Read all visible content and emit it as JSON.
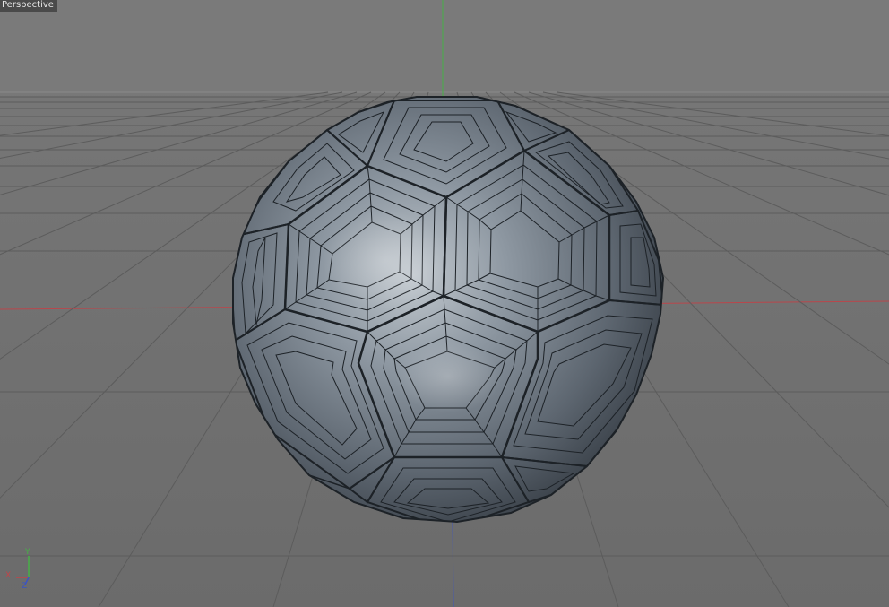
{
  "viewport": {
    "label": "Perspective"
  },
  "gizmo": {
    "y_label": "Y",
    "x_label": "X",
    "z_label": "Z"
  },
  "colors": {
    "background": "#777777",
    "grid_line": "#5f5f5f",
    "x_axis": "#c0454a",
    "y_axis": "#3fae3f",
    "z_axis": "#3a55c8",
    "ball_fill": "#7f8c97",
    "ball_edge": "#1e2328"
  },
  "scene": {
    "object": "soccer-ball-mesh",
    "icon": "truncated-icosahedron"
  }
}
